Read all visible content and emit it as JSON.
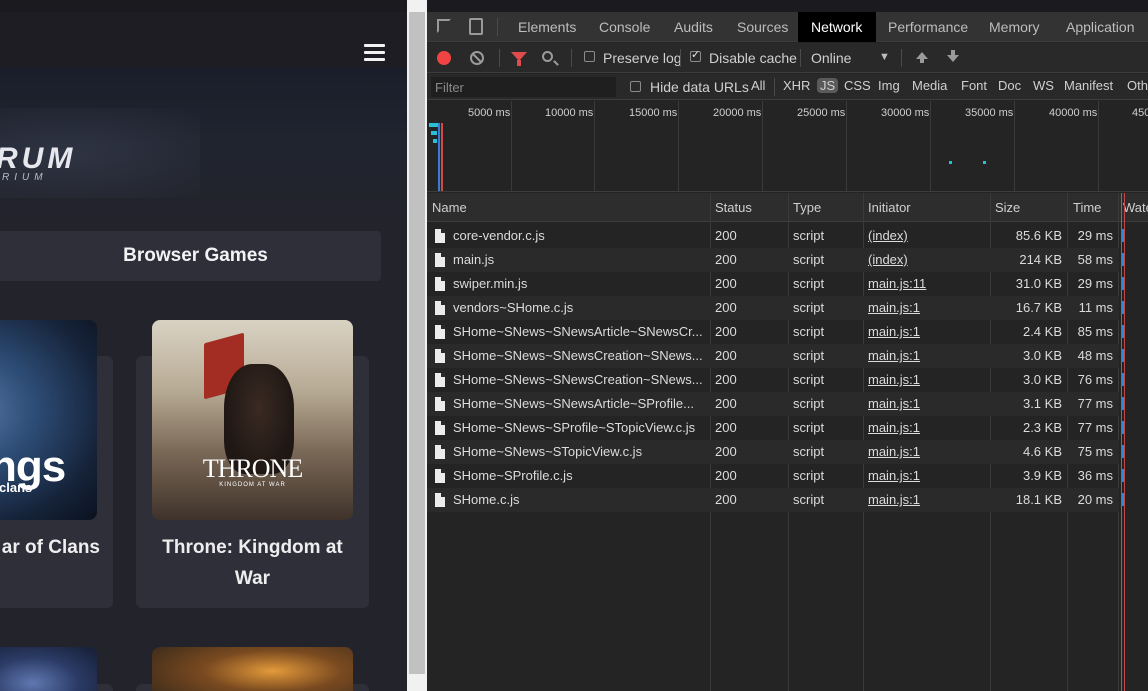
{
  "site": {
    "logo_main": "RUM",
    "logo_sub": "RIUM",
    "section_title": "Browser Games",
    "cards": [
      {
        "title": "ar of Clans",
        "art_text": "ngs",
        "art_sub": "clans"
      },
      {
        "title": "Throne: Kingdom at War",
        "art_text": "THRONE",
        "art_sub": "KINGDOM AT WAR"
      }
    ]
  },
  "devtools": {
    "tabs": [
      "Elements",
      "Console",
      "Audits",
      "Sources",
      "Network",
      "Performance",
      "Memory",
      "Application"
    ],
    "active_tab": "Network",
    "toolbar": {
      "preserve_log": "Preserve log",
      "preserve_log_checked": false,
      "disable_cache": "Disable cache",
      "disable_cache_checked": true,
      "throttling": "Online"
    },
    "filter": {
      "placeholder": "Filter",
      "hide_data_urls": "Hide data URLs",
      "types": [
        "All",
        "XHR",
        "JS",
        "CSS",
        "Img",
        "Media",
        "Font",
        "Doc",
        "WS",
        "Manifest",
        "Oth"
      ],
      "selected_type": "JS"
    },
    "overview_ticks": [
      "5000 ms",
      "10000 ms",
      "15000 ms",
      "20000 ms",
      "25000 ms",
      "30000 ms",
      "35000 ms",
      "40000 ms",
      "450"
    ],
    "columns": [
      "Name",
      "Status",
      "Type",
      "Initiator",
      "Size",
      "Time",
      "Wate"
    ],
    "requests": [
      {
        "name": "core-vendor.c.js",
        "status": "200",
        "type": "script",
        "initiator": "(index)",
        "size": "85.6 KB",
        "time": "29 ms"
      },
      {
        "name": "main.js",
        "status": "200",
        "type": "script",
        "initiator": "(index)",
        "size": "214 KB",
        "time": "58 ms"
      },
      {
        "name": "swiper.min.js",
        "status": "200",
        "type": "script",
        "initiator": "main.js:11",
        "size": "31.0 KB",
        "time": "29 ms"
      },
      {
        "name": "vendors~SHome.c.js",
        "status": "200",
        "type": "script",
        "initiator": "main.js:1",
        "size": "16.7 KB",
        "time": "11 ms"
      },
      {
        "name": "SHome~SNews~SNewsArticle~SNewsCr...",
        "status": "200",
        "type": "script",
        "initiator": "main.js:1",
        "size": "2.4 KB",
        "time": "85 ms"
      },
      {
        "name": "SHome~SNews~SNewsCreation~SNews...",
        "status": "200",
        "type": "script",
        "initiator": "main.js:1",
        "size": "3.0 KB",
        "time": "48 ms"
      },
      {
        "name": "SHome~SNews~SNewsCreation~SNews...",
        "status": "200",
        "type": "script",
        "initiator": "main.js:1",
        "size": "3.0 KB",
        "time": "76 ms"
      },
      {
        "name": "SHome~SNews~SNewsArticle~SProfile...",
        "status": "200",
        "type": "script",
        "initiator": "main.js:1",
        "size": "3.1 KB",
        "time": "77 ms"
      },
      {
        "name": "SHome~SNews~SProfile~STopicView.c.js",
        "status": "200",
        "type": "script",
        "initiator": "main.js:1",
        "size": "2.3 KB",
        "time": "77 ms"
      },
      {
        "name": "SHome~SNews~STopicView.c.js",
        "status": "200",
        "type": "script",
        "initiator": "main.js:1",
        "size": "4.6 KB",
        "time": "75 ms"
      },
      {
        "name": "SHome~SProfile.c.js",
        "status": "200",
        "type": "script",
        "initiator": "main.js:1",
        "size": "3.9 KB",
        "time": "36 ms"
      },
      {
        "name": "SHome.c.js",
        "status": "200",
        "type": "script",
        "initiator": "main.js:1",
        "size": "18.1 KB",
        "time": "20 ms"
      }
    ]
  }
}
